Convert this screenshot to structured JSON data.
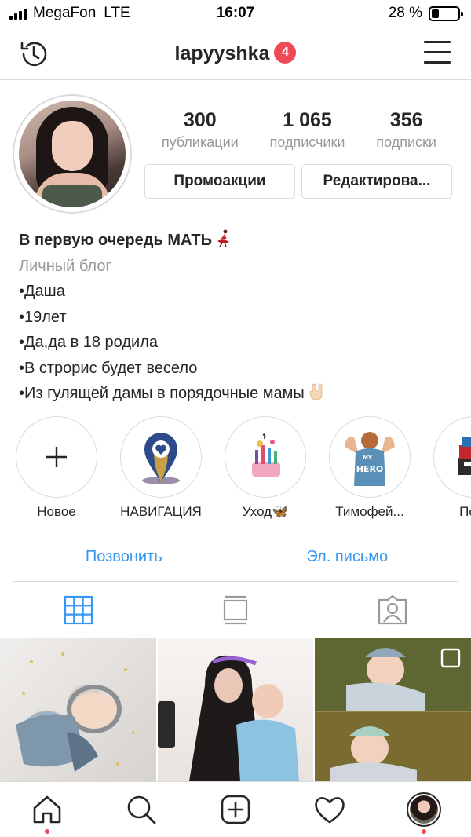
{
  "status_bar": {
    "carrier": "MegaFon",
    "network": "LTE",
    "time": "16:07",
    "battery_text": "28 %",
    "battery_level": 0.28
  },
  "header": {
    "username": "lapyyshka",
    "notifications": "4"
  },
  "stats": [
    {
      "value": "300",
      "label": "публикации"
    },
    {
      "value": "1 065",
      "label": "подписчики"
    },
    {
      "value": "356",
      "label": "подписки"
    }
  ],
  "buttons": {
    "promo": "Промоакции",
    "edit": "Редактирова..."
  },
  "bio": {
    "name": "В первую очередь МАТЬ",
    "category": "Личный блог",
    "lines": [
      "•Даша",
      "•19лет",
      "•Да,да в 18 родила",
      "•В строрис будет весело",
      "•Из гулящей дамы в порядочные мамы"
    ]
  },
  "highlights": [
    {
      "label": "Новое"
    },
    {
      "label": "НАВИГАЦИЯ"
    },
    {
      "label": "Уход🦋"
    },
    {
      "label": "Тимофей..."
    },
    {
      "label": "Поку"
    }
  ],
  "contact": {
    "call": "Позвонить",
    "email": "Эл. письмо"
  },
  "colors": {
    "link": "#3897f0",
    "badge": "#ed4956",
    "border": "#dbdbdb",
    "secondary_text": "#999999"
  }
}
